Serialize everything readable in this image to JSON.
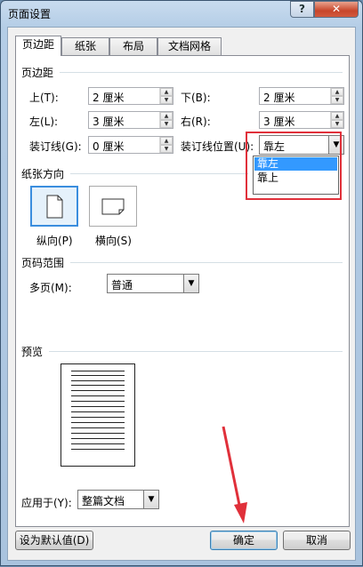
{
  "window": {
    "title": "页面设置",
    "help_label": "?",
    "close_label": "✕"
  },
  "tabs": [
    {
      "label": "页边距"
    },
    {
      "label": "纸张"
    },
    {
      "label": "布局"
    },
    {
      "label": "文档网格"
    }
  ],
  "margins": {
    "section_label": "页边距",
    "top": {
      "label": "上(T):",
      "value": "2 厘米"
    },
    "bottom": {
      "label": "下(B):",
      "value": "2 厘米"
    },
    "left": {
      "label": "左(L):",
      "value": "3 厘米"
    },
    "right": {
      "label": "右(R):",
      "value": "3 厘米"
    },
    "gutter": {
      "label": "装订线(G):",
      "value": "0 厘米"
    },
    "gutter_position": {
      "label": "装订线位置(U):",
      "value": "靠左",
      "options": [
        "靠左",
        "靠上"
      ]
    }
  },
  "orientation": {
    "section_label": "纸张方向",
    "portrait_label": "纵向(P)",
    "landscape_label": "横向(S)"
  },
  "pages": {
    "section_label": "页码范围",
    "multiple_label": "多页(M):",
    "multiple_value": "普通"
  },
  "preview": {
    "section_label": "预览"
  },
  "apply_to": {
    "label": "应用于(Y):",
    "value": "整篇文档"
  },
  "buttons": {
    "default_label": "设为默认值(D)",
    "ok_label": "确定",
    "cancel_label": "取消"
  },
  "colors": {
    "highlight": "#3399ff",
    "annotation": "#e0303a"
  }
}
